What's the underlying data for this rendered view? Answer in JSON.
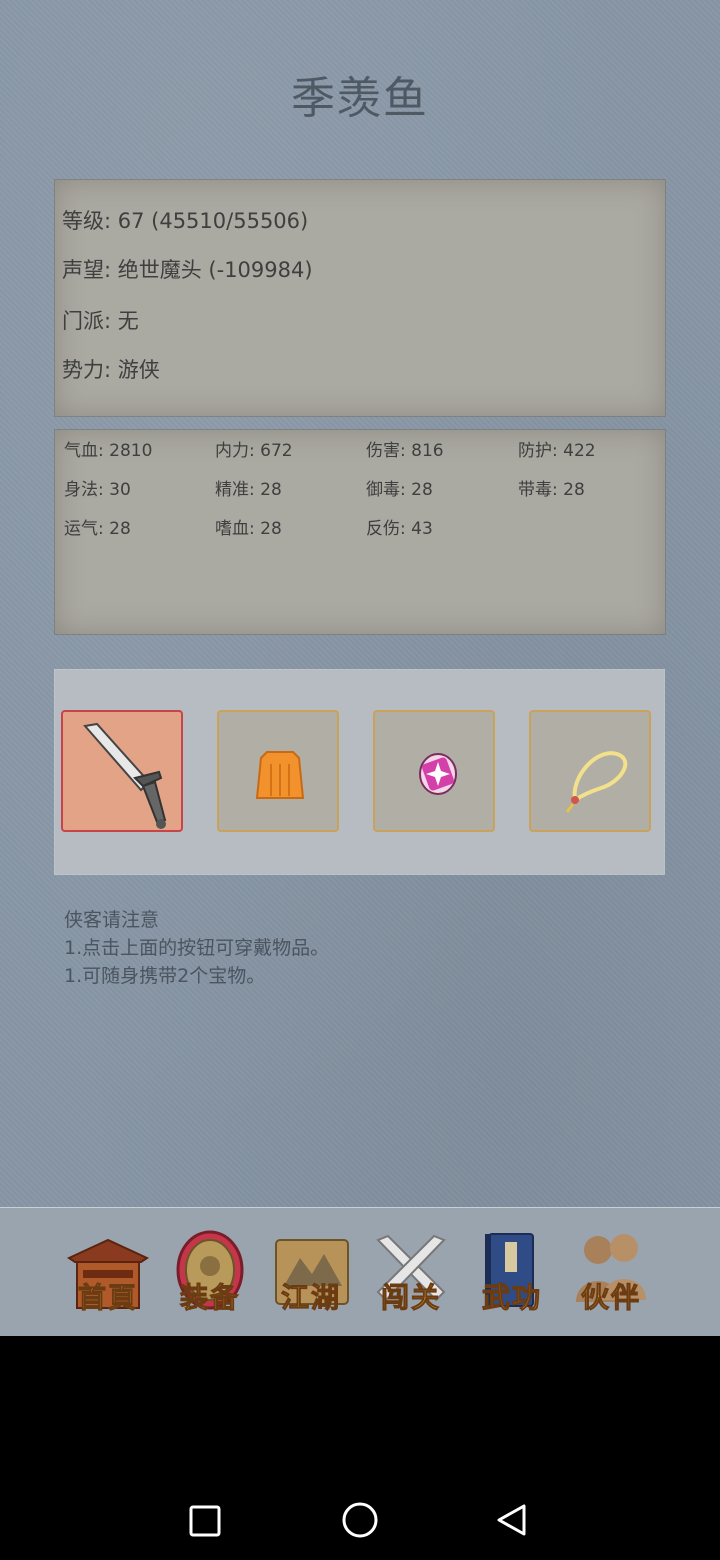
{
  "title": "季羡鱼",
  "info": {
    "level": "等级: 67 (45510/55506)",
    "reputation": "声望: 绝世魔头 (-109984)",
    "sect": "门派: 无",
    "faction": "势力:  游侠"
  },
  "stats": [
    {
      "text": "气血: 2810"
    },
    {
      "text": "内力: 672"
    },
    {
      "text": "伤害: 816"
    },
    {
      "text": "防护: 422"
    },
    {
      "text": "身法: 30"
    },
    {
      "text": "精准: 28"
    },
    {
      "text": "御毒: 28"
    },
    {
      "text": "带毒: 28"
    },
    {
      "text": "运气: 28"
    },
    {
      "text": "嗜血: 28"
    },
    {
      "text": "反伤: 43"
    }
  ],
  "equipment": [
    {
      "icon": "sword-icon",
      "selected": true
    },
    {
      "icon": "armor-icon",
      "selected": false
    },
    {
      "icon": "gem-icon",
      "selected": false
    },
    {
      "icon": "necklace-icon",
      "selected": false
    }
  ],
  "notice": {
    "heading": "侠客请注意",
    "line1": "1.点击上面的按钮可穿戴物品。",
    "line2": "1.可随身携带2个宝物。"
  },
  "nav": [
    {
      "label": "首頁",
      "icon": "house-icon"
    },
    {
      "label": "装备",
      "icon": "armor-icon"
    },
    {
      "label": "江湖",
      "icon": "scroll-map-icon"
    },
    {
      "label": "闯关",
      "icon": "crossed-swords-icon"
    },
    {
      "label": "武功",
      "icon": "book-icon"
    },
    {
      "label": "伙伴",
      "icon": "people-icon"
    }
  ],
  "colors": {
    "background": "#8796a6",
    "paper": "#aaa9a2",
    "slot_border": "#c9a25b",
    "slot_selected": "#e2a386",
    "nav_label": "#e9b43a"
  }
}
